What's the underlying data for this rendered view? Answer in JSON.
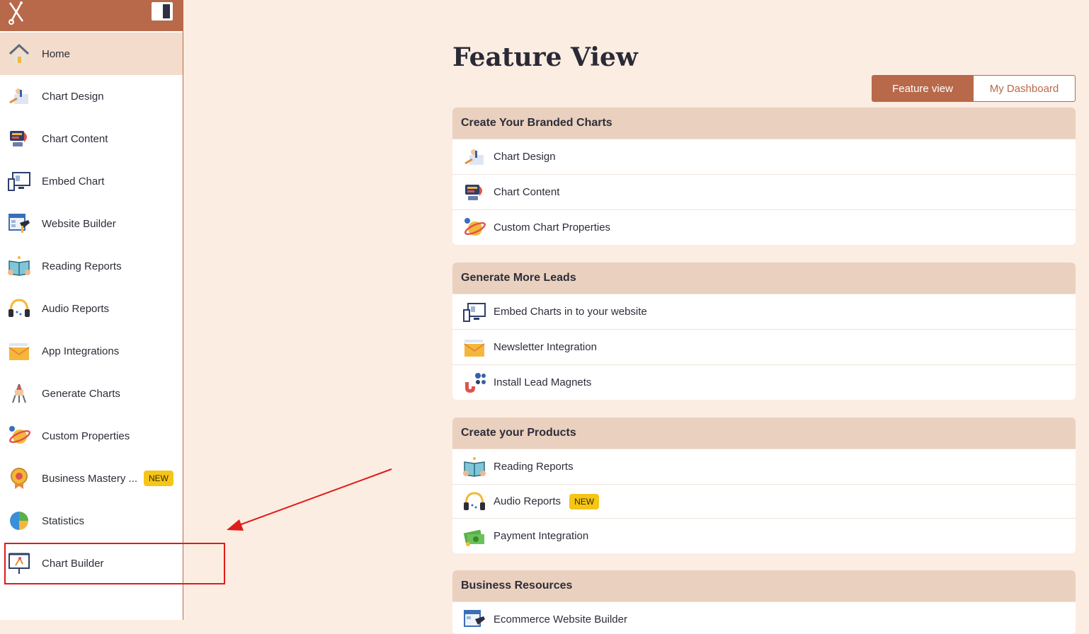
{
  "sidebar": {
    "items": [
      {
        "label": "Home",
        "icon": "home-icon"
      },
      {
        "label": "Chart Design",
        "icon": "chart-design-icon"
      },
      {
        "label": "Chart Content",
        "icon": "chart-content-icon"
      },
      {
        "label": "Embed Chart",
        "icon": "embed-chart-icon"
      },
      {
        "label": "Website Builder",
        "icon": "website-builder-icon"
      },
      {
        "label": "Reading Reports",
        "icon": "reading-reports-icon"
      },
      {
        "label": "Audio Reports",
        "icon": "headphones-icon"
      },
      {
        "label": "App Integrations",
        "icon": "envelope-icon"
      },
      {
        "label": "Generate Charts",
        "icon": "generate-charts-icon"
      },
      {
        "label": "Custom Properties",
        "icon": "planet-icon"
      },
      {
        "label": "Business Mastery ...",
        "icon": "medal-icon",
        "badge": "NEW"
      },
      {
        "label": "Statistics",
        "icon": "pie-chart-icon"
      },
      {
        "label": "Chart Builder",
        "icon": "easel-icon"
      }
    ]
  },
  "main": {
    "title": "Feature View",
    "toggle": {
      "active": "Feature view",
      "inactive": "My Dashboard"
    },
    "sections": [
      {
        "title": "Create Your Branded Charts",
        "rows": [
          {
            "label": "Chart Design"
          },
          {
            "label": "Chart Content"
          },
          {
            "label": "Custom Chart Properties"
          }
        ]
      },
      {
        "title": "Generate More Leads",
        "rows": [
          {
            "label": "Embed Charts in to your website"
          },
          {
            "label": "Newsletter Integration"
          },
          {
            "label": "Install Lead Magnets"
          }
        ]
      },
      {
        "title": "Create your Products",
        "rows": [
          {
            "label": "Reading Reports"
          },
          {
            "label": "Audio Reports",
            "badge": "NEW"
          },
          {
            "label": "Payment Integration"
          }
        ]
      },
      {
        "title": "Business Resources",
        "rows": [
          {
            "label": "Ecommerce Website Builder"
          }
        ]
      }
    ]
  },
  "colors": {
    "accent": "#b8694a",
    "background": "#fcede2",
    "header": "#ead0be",
    "badge": "#f5c518",
    "annotation": "#e01b1b"
  }
}
